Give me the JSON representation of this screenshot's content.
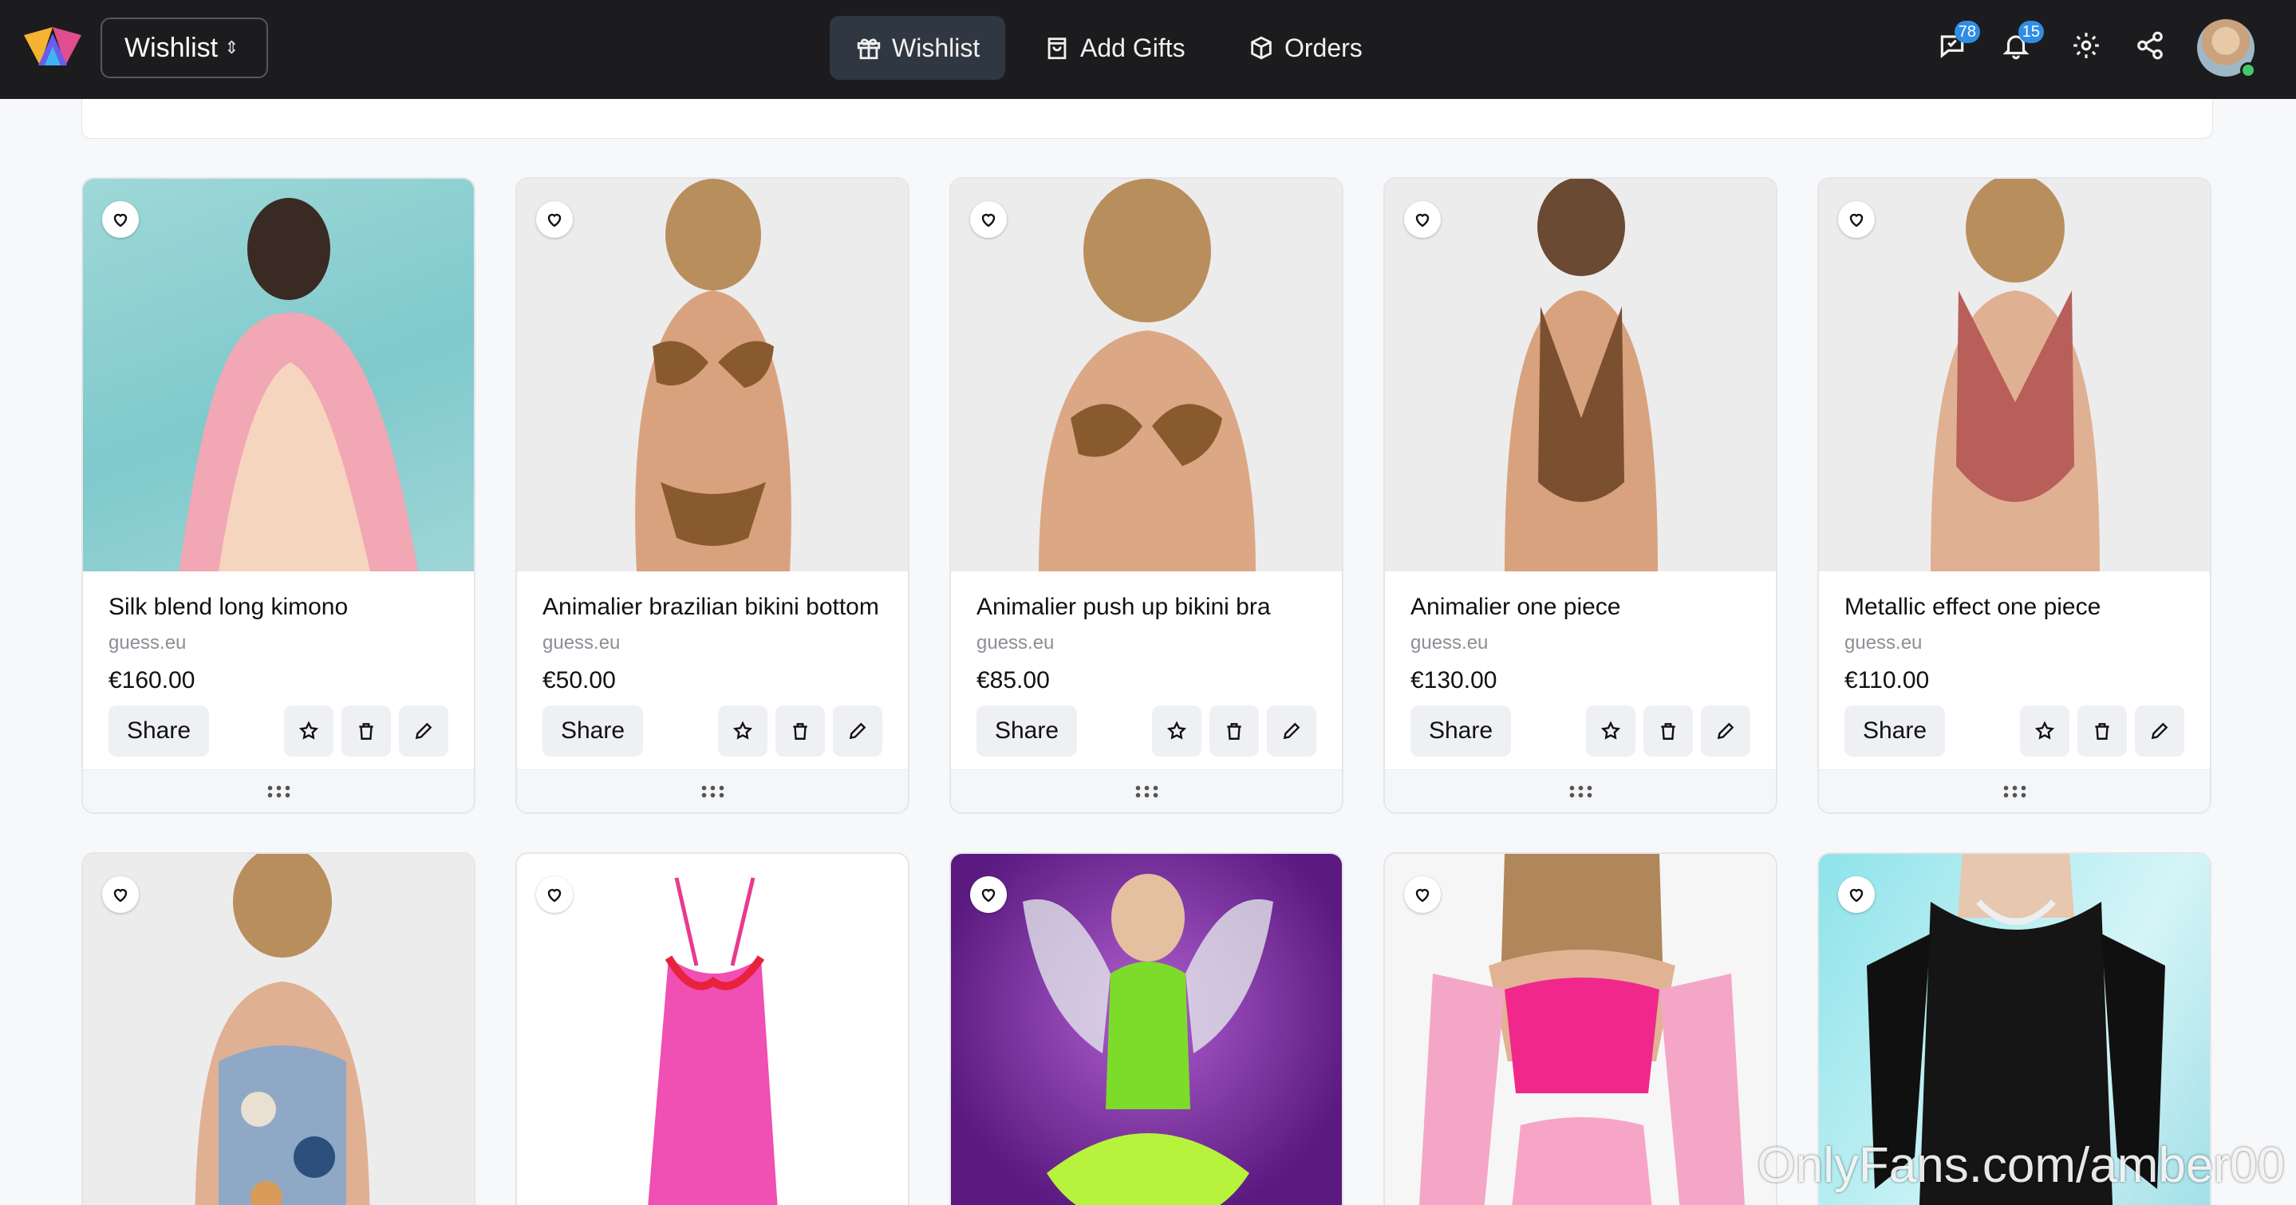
{
  "header": {
    "switcher_label": "Wishlist",
    "nav": [
      {
        "label": "Wishlist",
        "icon": "gift-icon",
        "active": true
      },
      {
        "label": "Add Gifts",
        "icon": "shopping-bag-icon",
        "active": false
      },
      {
        "label": "Orders",
        "icon": "package-icon",
        "active": false
      }
    ],
    "messages_count": "78",
    "notifications_count": "15",
    "accent": "#2f8de4"
  },
  "products": [
    {
      "title": "Silk blend long kimono",
      "store": "guess.eu",
      "price": "€160.00",
      "share": "Share"
    },
    {
      "title": "Animalier brazilian bikini bottom",
      "store": "guess.eu",
      "price": "€50.00",
      "share": "Share"
    },
    {
      "title": "Animalier push up bikini bra",
      "store": "guess.eu",
      "price": "€85.00",
      "share": "Share"
    },
    {
      "title": "Animalier one piece",
      "store": "guess.eu",
      "price": "€130.00",
      "share": "Share"
    },
    {
      "title": "Metallic effect one piece",
      "store": "guess.eu",
      "price": "€110.00",
      "share": "Share"
    }
  ],
  "watermark": "OnlyFans.com/amber00"
}
